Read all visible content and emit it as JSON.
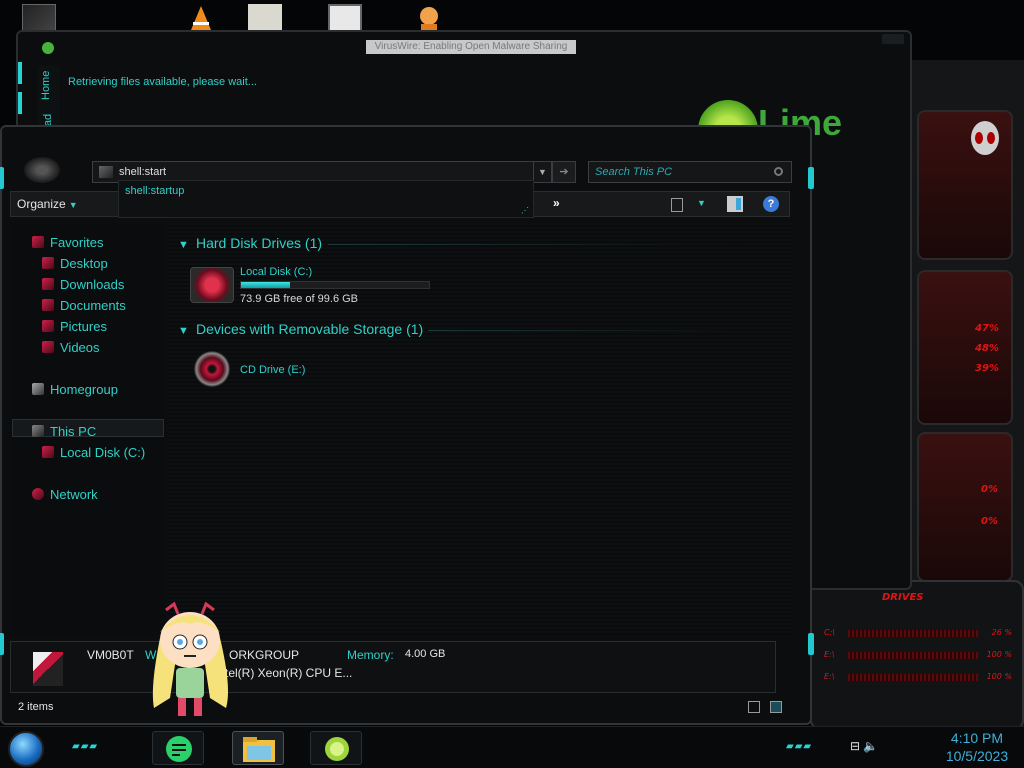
{
  "background_window": {
    "title": "VirusWire: Enabling Open Malware Sharing",
    "side_tab_home": "Home",
    "side_tab_partial": "ad",
    "status_message": "Retrieving files available, please wait...",
    "logo_text": "Lime"
  },
  "explorer": {
    "address_value": "shell:start",
    "search_placeholder": "Search This PC",
    "autocomplete": [
      "shell:startup"
    ],
    "toolbar": {
      "organize": "Organize",
      "more": "»",
      "help": "?"
    },
    "nav": {
      "favorites": "Favorites",
      "desktop": "Desktop",
      "downloads": "Downloads",
      "documents": "Documents",
      "pictures": "Pictures",
      "videos": "Videos",
      "homegroup": "Homegroup",
      "this_pc": "This PC",
      "local_disk": "Local Disk (C:)",
      "network": "Network"
    },
    "groups": {
      "hard_disks": "Hard Disk Drives (1)",
      "removable": "Devices with Removable Storage (1)"
    },
    "drives": {
      "c_name": "Local Disk (C:)",
      "c_free_text": "73.9 GB free of 99.6 GB",
      "c_used_fraction": 0.258,
      "e_name": "CD Drive (E:)"
    },
    "details": {
      "computer_name": "VM0B0T",
      "workgroup_label_partial": "W",
      "workgroup_value_partial": "ORKGROUP",
      "memory_label": "Memory:",
      "memory_value": "4.00 GB",
      "cpu_partial": "tel(R) Xeon(R) CPU E..."
    },
    "status_count": "2 items"
  },
  "widget": {
    "drives_title": "DRIVES",
    "drive_rows": [
      {
        "label": "C:\\",
        "pct": "26 %"
      },
      {
        "label": "E:\\",
        "pct": "100 %"
      },
      {
        "label": "E:\\",
        "pct": "100 %"
      }
    ],
    "stats": [
      "47%",
      "48%",
      "39%",
      "0%",
      "0%"
    ]
  },
  "taskbar": {
    "time": "4:10 PM",
    "date": "10/5/2023"
  }
}
